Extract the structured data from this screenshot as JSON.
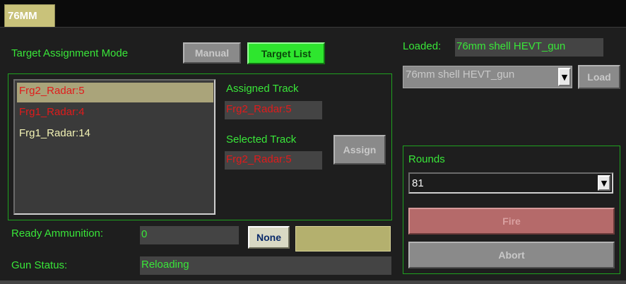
{
  "tab": {
    "label": "76MM"
  },
  "target_assignment": {
    "label": "Target Assignment Mode",
    "manual_button": "Manual",
    "target_list_button": "Target List"
  },
  "tracks": {
    "items": [
      {
        "label": "Frg2_Radar:5",
        "color": "#e01b1b",
        "selected": true
      },
      {
        "label": "Frg1_Radar:4",
        "color": "#e01b1b",
        "selected": false
      },
      {
        "label": "Frg1_Radar:14",
        "color": "#f3f3b5",
        "selected": false
      }
    ],
    "assigned_label": "Assigned Track",
    "assigned_value": "Frg2_Radar:5",
    "selected_label": "Selected Track",
    "selected_value": "Frg2_Radar:5",
    "assign_button": "Assign"
  },
  "ammo": {
    "ready_label": "Ready Ammunition:",
    "ready_value": "0",
    "none_button": "None",
    "gun_status_label": "Gun Status:",
    "gun_status_value": "Reloading"
  },
  "loading": {
    "loaded_label": "Loaded:",
    "loaded_value": "76mm shell HEVT_gun",
    "shell_select": "76mm shell HEVT_gun",
    "load_button": "Load"
  },
  "rounds": {
    "label": "Rounds",
    "value": "81",
    "fire_button": "Fire",
    "abort_button": "Abort"
  },
  "colors": {
    "accent_green": "#39e639",
    "track_red": "#e01b1b",
    "track_yellow": "#f3f3b5",
    "tab_khaki": "#c9c27a"
  }
}
